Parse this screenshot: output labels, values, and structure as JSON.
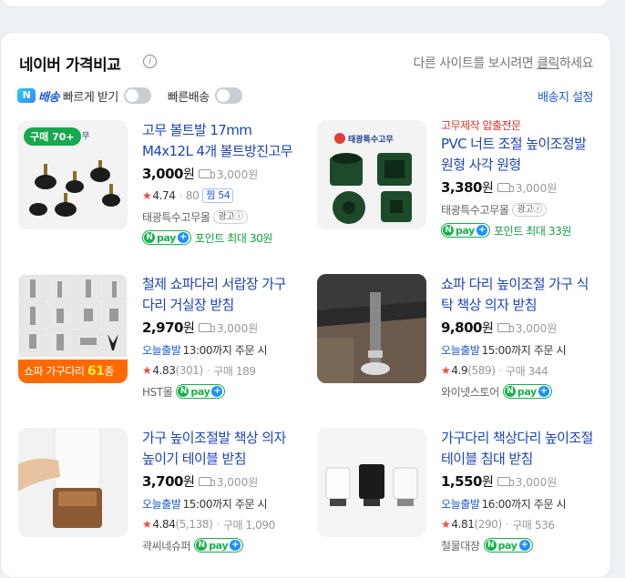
{
  "header": {
    "title": "네이버 가격비교",
    "info_icon": "i",
    "other_sites_prefix": "다른 사이트를 보시려면 ",
    "other_sites_link": "클릭",
    "other_sites_suffix": "하세요"
  },
  "filters": {
    "n_badge": "N",
    "baesong": "배송",
    "fast_receive": "빠르게 받기",
    "fast_delivery": "빠른배송",
    "ship_settings": "배송지 설정"
  },
  "products": [
    {
      "badge": "구매 70+",
      "name": "고무 볼트발 17mm M4x12L 4개 볼트방진고무",
      "price": "3,000",
      "unit": "원",
      "ship": "3,000원",
      "rating": "4.74",
      "reviews": "80",
      "zzim": "찜 54",
      "seller": "태광특수고무몰",
      "ad": "광고ⓘ",
      "point": "포인트 최대 30원"
    },
    {
      "promo": "고무제작 압출전문",
      "name": "PVC 너트 조절 높이조정발 원형 사각 원형",
      "price": "3,380",
      "unit": "원",
      "ship": "3,000원",
      "seller": "태광특수고무몰",
      "ad": "광고ⓘ",
      "point": "포인트 최대 33원"
    },
    {
      "badge_text": "쇼파 가구다리",
      "badge_num": "61",
      "badge_suffix": "종",
      "name": "철제 쇼파다리 서랍장 가구다리 거실장 받침",
      "price": "2,970",
      "unit": "원",
      "ship": "3,000원",
      "today": "오늘출발",
      "order_by": "13:00까지 주문 시",
      "rating": "4.83",
      "reviews": "(301)",
      "buy": "구매 189",
      "seller": "HST몰"
    },
    {
      "name": "쇼파 다리 높이조절 가구 식탁 책상 의자 받침",
      "price": "9,800",
      "unit": "원",
      "ship": "3,000원",
      "today": "오늘출발",
      "order_by": "15:00까지 주문 시",
      "rating": "4.9",
      "reviews": "(589)",
      "buy": "구매 344",
      "seller": "와이넷스토어"
    },
    {
      "name": "가구 높이조절발 책상 의자 높이기 테이블 받침",
      "price": "3,700",
      "unit": "원",
      "ship": "3,000원",
      "today": "오늘출발",
      "order_by": "15:00까지 주문 시",
      "rating": "4.84",
      "reviews": "(5,138)",
      "buy": "구매 1,090",
      "seller": "곽씨네슈퍼"
    },
    {
      "name": "가구다리 책상다리 높이조절 테이블 침대 받침",
      "price": "1,550",
      "unit": "원",
      "ship": "3,000원",
      "today": "오늘출발",
      "order_by": "16:00까지 주문 시",
      "rating": "4.81",
      "reviews": "(290)",
      "buy": "구매 536",
      "seller": "철물대장"
    }
  ],
  "npay": {
    "n": "N",
    "p": "pay",
    "plus": "+"
  },
  "colors": {
    "link_blue": "#1e45b8",
    "accent_blue": "#1e5bd8",
    "star_red": "#f04848",
    "npay_green": "#14b248",
    "badge_orange": "#ff6a00"
  }
}
